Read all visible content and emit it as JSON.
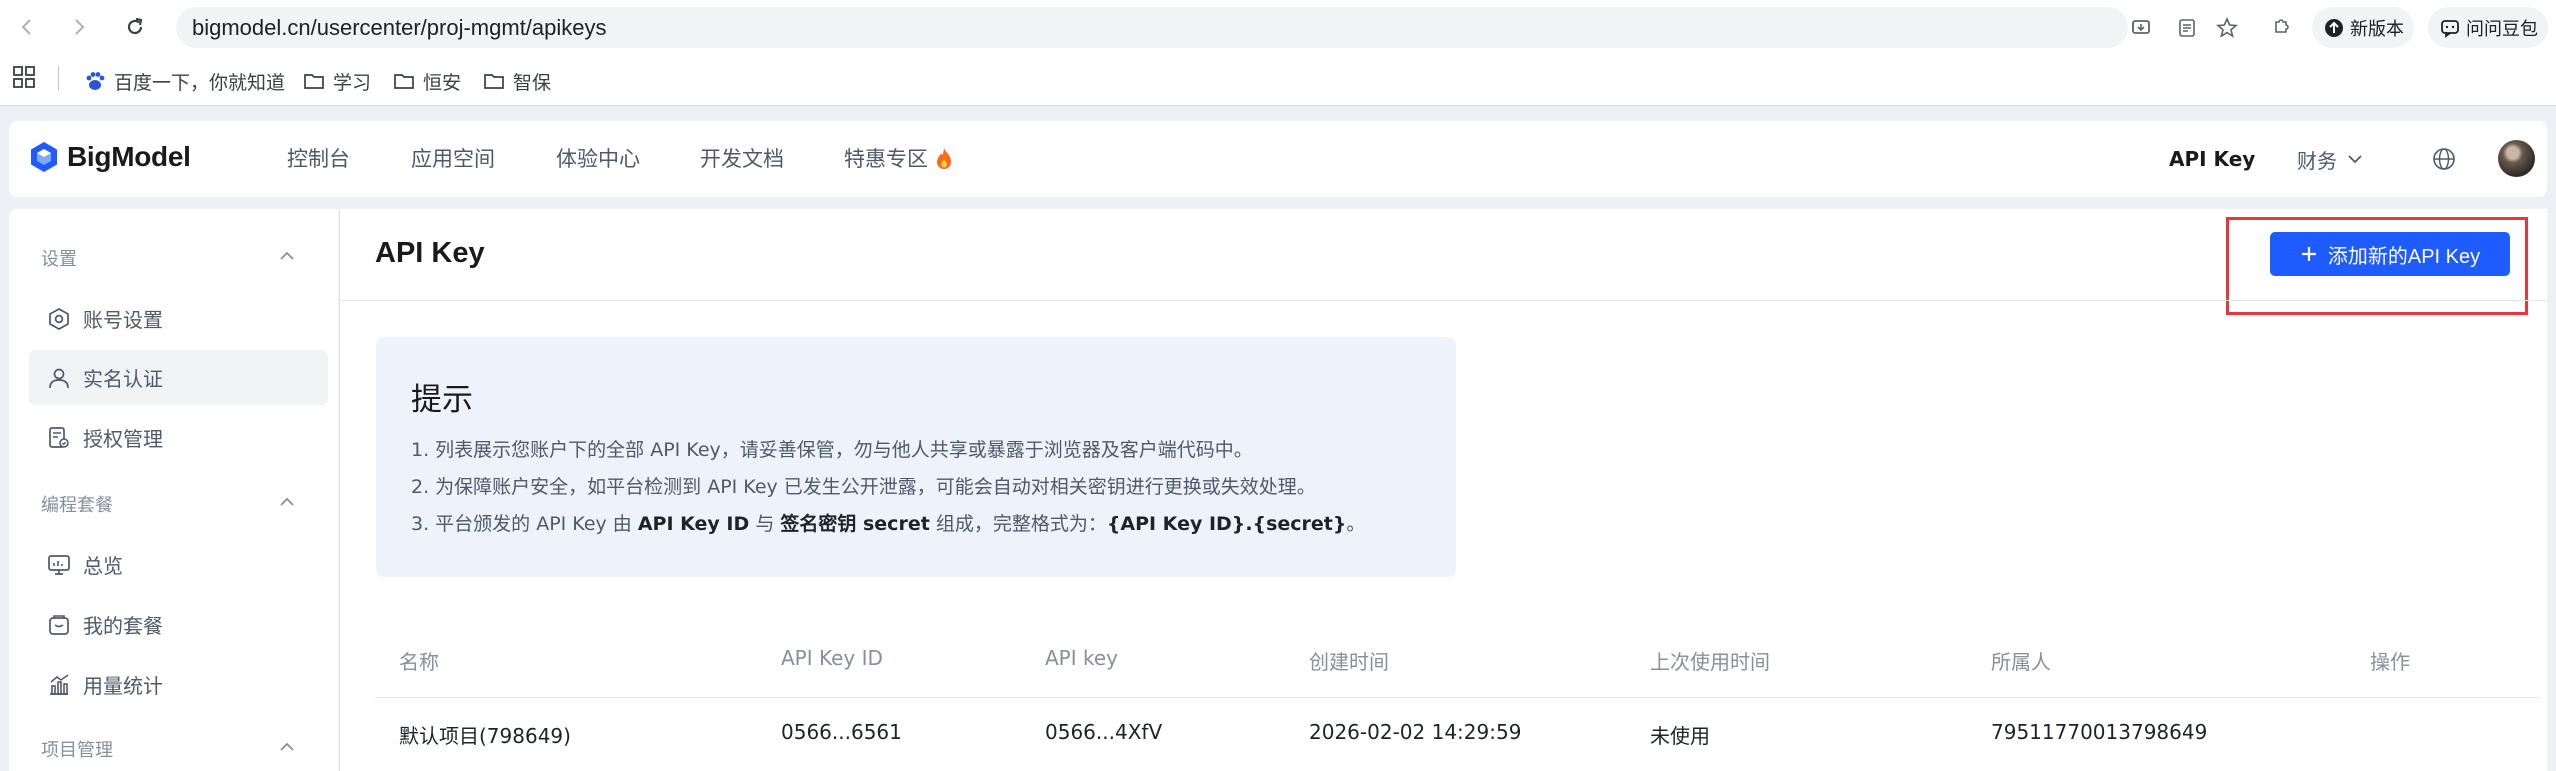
{
  "browser": {
    "url": "bigmodel.cn/usercenter/proj-mgmt/apikeys",
    "pills": [
      {
        "label": "新版本"
      },
      {
        "label": "问问豆包"
      }
    ],
    "bookmarks": [
      {
        "label": "百度一下，你就知道",
        "icon": "baidu-paw-icon"
      },
      {
        "label": "学习",
        "icon": "folder-icon"
      },
      {
        "label": "恒安",
        "icon": "folder-icon"
      },
      {
        "label": "智保",
        "icon": "folder-icon"
      }
    ]
  },
  "header": {
    "logo_text": "BigModel",
    "nav": [
      "控制台",
      "应用空间",
      "体验中心",
      "开发文档",
      "特惠专区"
    ],
    "api_key_label": "API Key",
    "finance_label": "财务"
  },
  "sidebar": {
    "sections": [
      {
        "title": "设置",
        "items": [
          {
            "label": "账号设置",
            "icon": "settings-hex-icon"
          },
          {
            "label": "实名认证",
            "icon": "user-icon",
            "active": true
          },
          {
            "label": "授权管理",
            "icon": "authorization-doc-icon"
          }
        ]
      },
      {
        "title": "编程套餐",
        "items": [
          {
            "label": "总览",
            "icon": "monitor-icon"
          },
          {
            "label": "我的套餐",
            "icon": "package-icon"
          },
          {
            "label": "用量统计",
            "icon": "usage-chart-icon"
          }
        ]
      },
      {
        "title": "项目管理",
        "items": []
      }
    ]
  },
  "main": {
    "title": "API Key",
    "add_button": "添加新的API Key",
    "tip": {
      "title": "提示",
      "line1": "1. 列表展示您账户下的全部 API Key，请妥善保管，勿与他人共享或暴露于浏览器及客户端代码中。",
      "line2": "2. 为保障账户安全，如平台检测到 API Key 已发生公开泄露，可能会自动对相关密钥进行更换或失效处理。",
      "line3_a": "3. 平台颁发的 API Key 由 ",
      "line3_b": "API Key ID",
      "line3_c": " 与 ",
      "line3_d": "签名密钥 secret",
      "line3_e": " 组成，完整格式为：",
      "line3_f": "{API Key ID}.{secret}",
      "line3_g": "。"
    },
    "table": {
      "columns": [
        "名称",
        "API Key ID",
        "API key",
        "创建时间",
        "上次使用时间",
        "所属人",
        "操作"
      ],
      "rows": [
        [
          "默认项目(798649)",
          "0566...6561",
          "0566...4XfV",
          "2026-02-02 14:29:59",
          "未使用",
          "79511770013798649",
          ""
        ]
      ]
    }
  },
  "colors": {
    "primary": "#1f5cff",
    "highlight": "#e8363b",
    "tip_bg": "#eef2fb"
  }
}
